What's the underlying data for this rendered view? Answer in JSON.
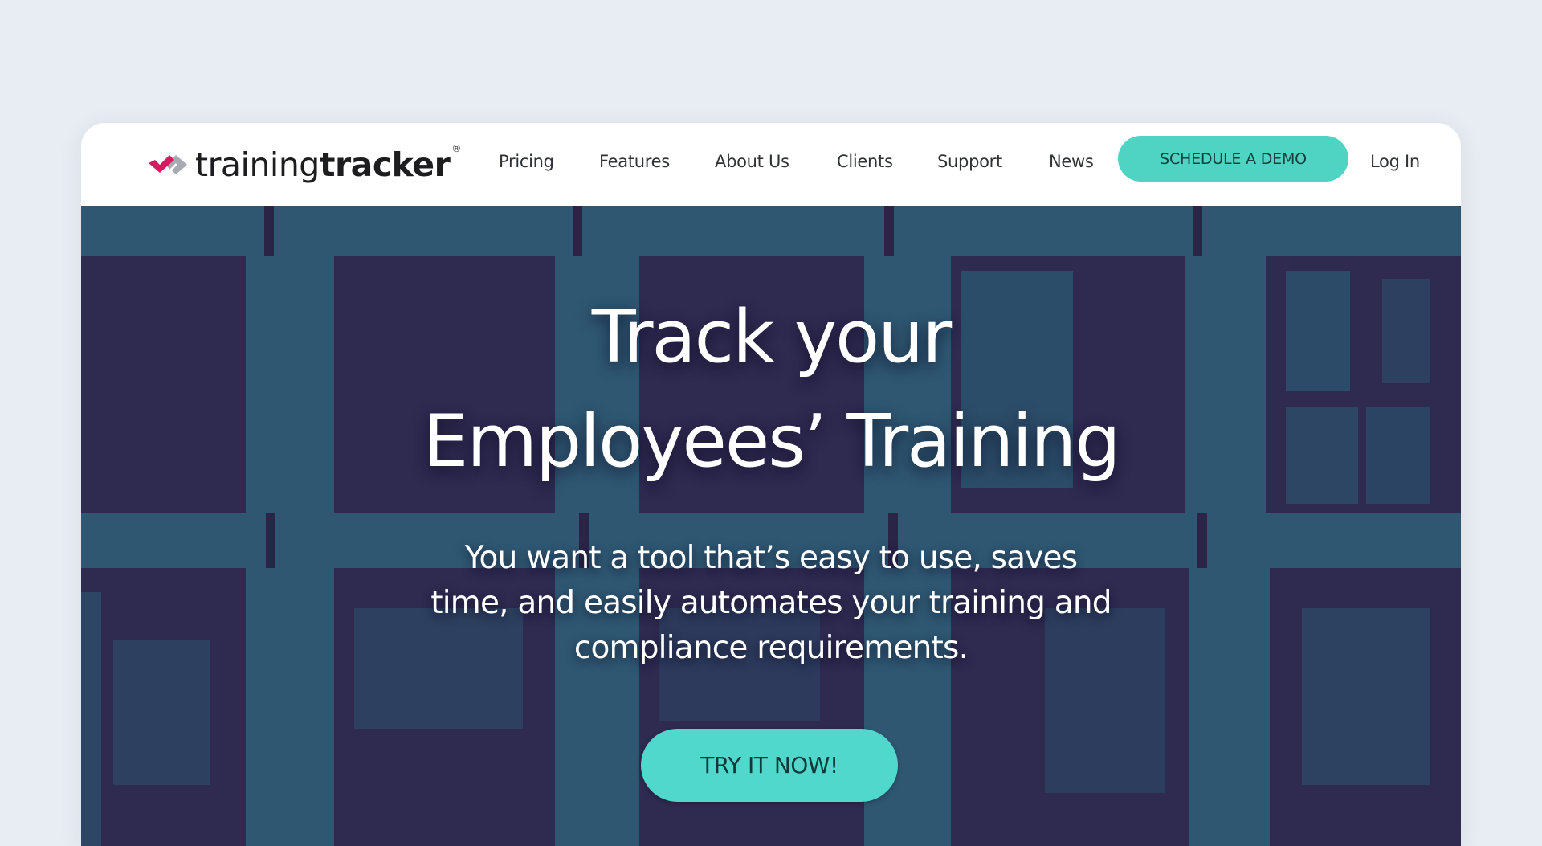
{
  "brand": {
    "name_light": "training",
    "name_bold": "tracker",
    "registered_mark": "®",
    "logo_icon": "check-arrow-icon",
    "colors": {
      "logo_primary": "#d81b60",
      "logo_secondary": "#a8aab2",
      "accent": "#4fd4c4",
      "hero_dark": "#2e2a50",
      "hero_teal": "#2f5772",
      "page_bg": "#e8ecf3"
    }
  },
  "nav": {
    "items": [
      {
        "label": "Pricing"
      },
      {
        "label": "Features"
      },
      {
        "label": "About Us"
      },
      {
        "label": "Clients"
      },
      {
        "label": "Support"
      },
      {
        "label": "News"
      }
    ],
    "cta_label": "SCHEDULE A DEMO",
    "login_label": "Log In"
  },
  "hero": {
    "title_line1": "Track your",
    "title_line2": "Employees’ Training",
    "subtitle_lines": [
      "You want a tool that’s easy to use, saves",
      "time, and easily automates your training and",
      "compliance requirements."
    ],
    "cta_label": "TRY IT NOW!"
  }
}
